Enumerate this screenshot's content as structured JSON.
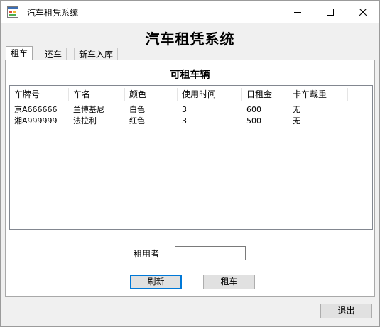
{
  "window": {
    "title": "汽车租凭系统",
    "controls": {
      "minimize": "minimize-icon",
      "maximize": "maximize-icon",
      "close": "close-icon"
    }
  },
  "heading": "汽车租凭系统",
  "tabs": [
    {
      "label": "租车",
      "active": true
    },
    {
      "label": "还车",
      "active": false
    },
    {
      "label": "新车入库",
      "active": false
    }
  ],
  "panel": {
    "section_title": "可租车辆",
    "table": {
      "columns": [
        "车牌号",
        "车名",
        "颜色",
        "使用时间",
        "日租金",
        "卡车载重"
      ],
      "rows": [
        [
          "京A666666",
          "兰博基尼",
          "白色",
          "3",
          "600",
          "无"
        ],
        [
          "湘A999999",
          "法拉利",
          "红色",
          "3",
          "500",
          "无"
        ]
      ]
    },
    "renter_label": "租用者",
    "renter_value": "",
    "refresh_button": "刷新",
    "rent_button": "租车"
  },
  "exit_button": "退出"
}
